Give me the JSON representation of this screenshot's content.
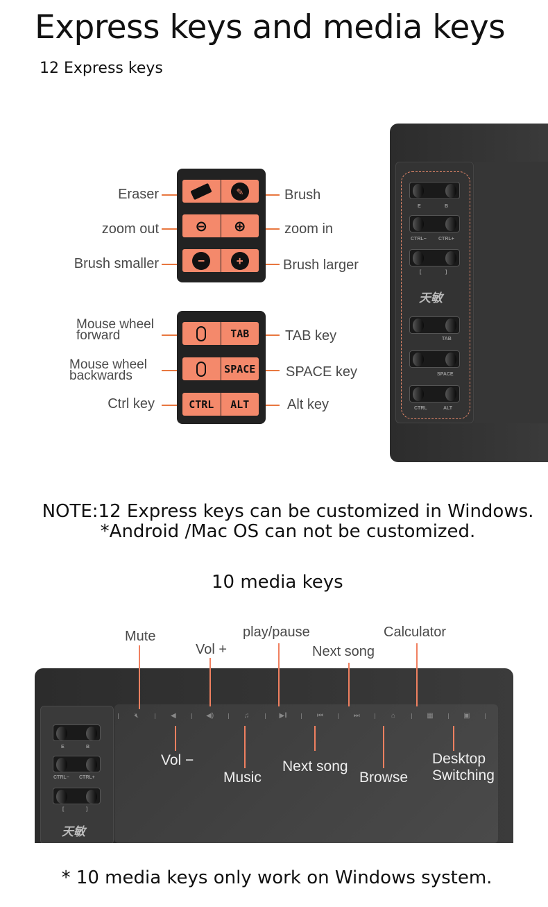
{
  "title": "Express keys and media keys",
  "express": {
    "heading": "12 Express keys",
    "left_labels": [
      "Eraser",
      "zoom out",
      "Brush smaller"
    ],
    "right_labels": [
      "Brush",
      "zoom in",
      "Brush larger"
    ],
    "left_labels2": [
      "Mouse wheel forward",
      "Mouse wheel backwards",
      "Ctrl key"
    ],
    "right_labels2": [
      "TAB key",
      "SPACE  key",
      "Alt key"
    ],
    "keys2": [
      [
        "mouse-wheel-up",
        "TAB"
      ],
      [
        "mouse-wheel-down",
        "SPACE"
      ],
      [
        "CTRL",
        "ALT"
      ]
    ],
    "tablet_labels": [
      "E",
      "B",
      "CTRL−",
      "CTRL+",
      "[",
      "]",
      "TAB",
      "SPACE",
      "CTRL",
      "ALT"
    ],
    "logo": "天敏"
  },
  "note": {
    "line1": "NOTE:12 Express keys can be customized in Windows.",
    "line2": "*Android /Mac OS can not be customized."
  },
  "media": {
    "heading": "10 media keys",
    "top_labels": [
      "Mute",
      "Vol +",
      "play/pause",
      "Next song",
      "Calculator"
    ],
    "bottom_labels": [
      "Vol −",
      "Music",
      "Next song",
      "Browse",
      "Desktop Switching"
    ],
    "icons": [
      "mute-icon",
      "volume-down-icon",
      "volume-up-icon",
      "music-icon",
      "play-pause-icon",
      "previous-icon",
      "next-icon",
      "home-icon",
      "calculator-icon",
      "desktop-icon"
    ],
    "footnote": "* 10 media keys only work on Windows system."
  },
  "colors": {
    "accent": "#f4896b",
    "line": "#e8773f",
    "tablet": "#2c2c2c"
  }
}
